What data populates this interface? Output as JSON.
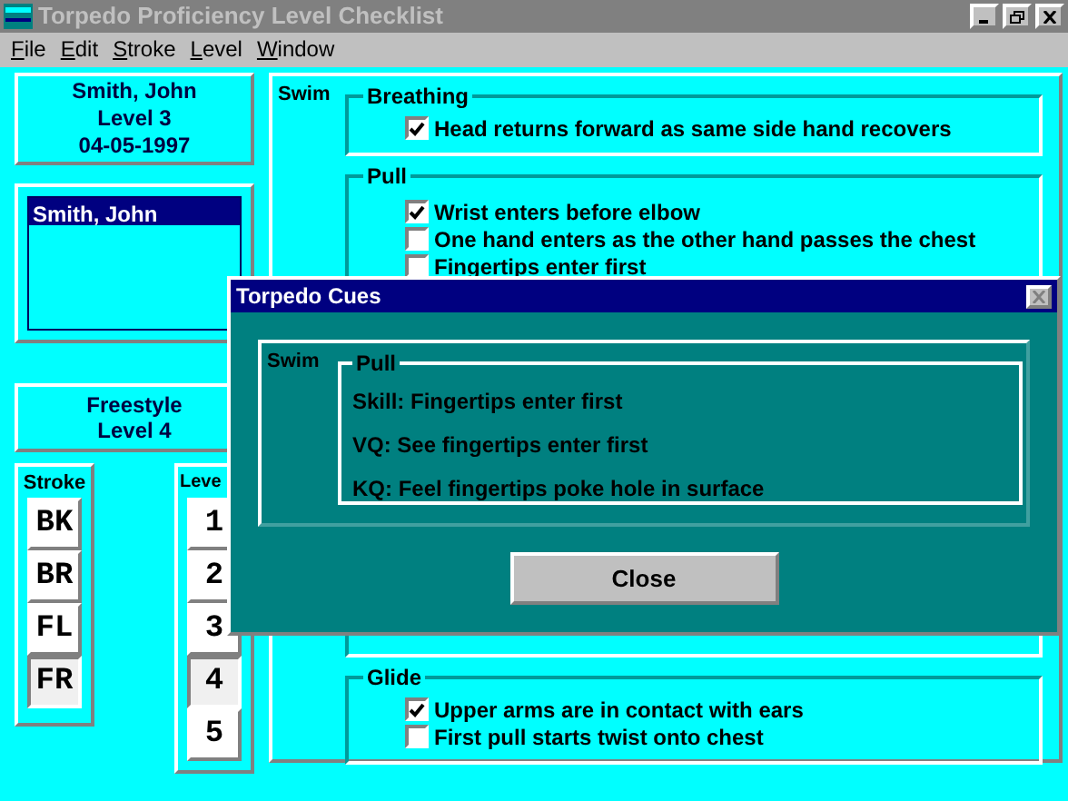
{
  "window": {
    "title": "Torpedo Proficiency Level Checklist"
  },
  "menu": [
    "File",
    "Edit",
    "Stroke",
    "Level",
    "Window"
  ],
  "swimmer_card": {
    "name": "Smith, John",
    "level": "Level 3",
    "date": "04-05-1997"
  },
  "swimmer_list": [
    {
      "name": "Smith, John",
      "selected": true
    }
  ],
  "stroke_card": {
    "stroke": "Freestyle",
    "level": "Level 4"
  },
  "stroke_group": {
    "label": "Stroke",
    "buttons": [
      {
        "label": "BK",
        "selected": false
      },
      {
        "label": "BR",
        "selected": false
      },
      {
        "label": "FL",
        "selected": false
      },
      {
        "label": "FR",
        "selected": true
      }
    ]
  },
  "level_group": {
    "label": "Leve",
    "buttons": [
      {
        "label": "1",
        "selected": false
      },
      {
        "label": "2",
        "selected": false
      },
      {
        "label": "3",
        "selected": false
      },
      {
        "label": "4",
        "selected": true
      },
      {
        "label": "5",
        "selected": false
      }
    ]
  },
  "checklist": {
    "label": "Swim",
    "groups": [
      {
        "title": "Breathing",
        "items": [
          {
            "text": "Head returns forward as same side hand recovers",
            "checked": true
          }
        ]
      },
      {
        "title": "Pull",
        "items": [
          {
            "text": "Wrist enters before elbow",
            "checked": true
          },
          {
            "text": "One hand enters as the other hand passes the chest",
            "checked": false
          },
          {
            "text": "Fingertips enter first",
            "checked": false
          }
        ]
      },
      {
        "title": "Glide",
        "items": [
          {
            "text": "Upper arms are in contact with ears",
            "checked": true
          },
          {
            "text": "First pull starts twist onto chest",
            "checked": false
          }
        ]
      }
    ]
  },
  "dialog": {
    "title": "Torpedo Cues",
    "label": "Swim",
    "group": "Pull",
    "lines": [
      "Skill: Fingertips enter first",
      "VQ: See fingertips enter first",
      "KQ: Feel fingertips poke hole in surface"
    ],
    "button": "Close"
  }
}
